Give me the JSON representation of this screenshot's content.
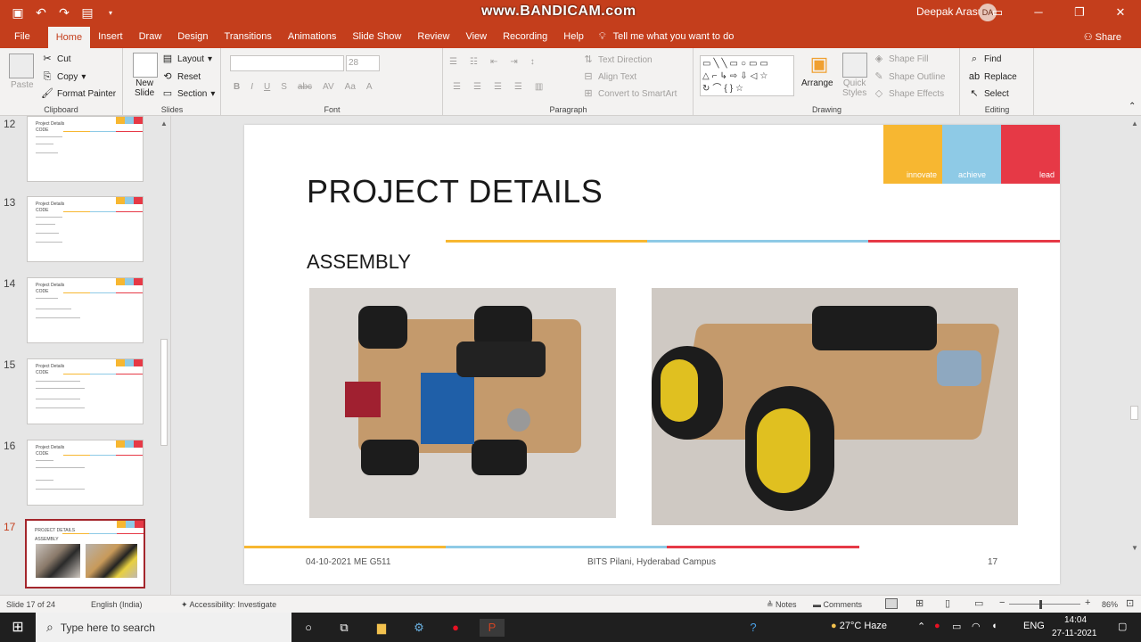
{
  "watermark": "www.BANDICAM.com",
  "user": {
    "name": "Deepak Arasu",
    "initials": "DA"
  },
  "window_controls": {
    "ribbon_display": "ribbon-display-icon",
    "minimize": "─",
    "restore": "❐",
    "close": "✕"
  },
  "qat": {
    "save": "save-icon",
    "undo": "undo-icon",
    "redo": "redo-icon",
    "present": "present-icon"
  },
  "tabs": [
    "File",
    "Home",
    "Insert",
    "Draw",
    "Design",
    "Transitions",
    "Animations",
    "Slide Show",
    "Review",
    "View",
    "Recording",
    "Help"
  ],
  "tell_me": "Tell me what you want to do",
  "share": "Share",
  "ribbon": {
    "clipboard": {
      "paste": "Paste",
      "cut": "Cut",
      "copy": "Copy",
      "format_painter": "Format Painter",
      "label": "Clipboard"
    },
    "slides": {
      "new_slide_1": "New",
      "new_slide_2": "Slide",
      "layout": "Layout",
      "reset": "Reset",
      "section": "Section",
      "label": "Slides"
    },
    "font": {
      "size": "28",
      "label": "Font",
      "bold": "B",
      "italic": "I",
      "underline": "U",
      "shadow": "S",
      "strike": "abc",
      "spacing": "AV",
      "case": "Aa",
      "color": "A"
    },
    "paragraph": {
      "text_direction": "Text Direction",
      "align_text": "Align Text",
      "smartart": "Convert to SmartArt",
      "label": "Paragraph"
    },
    "drawing": {
      "arrange": "Arrange",
      "quick_styles_1": "Quick",
      "quick_styles_2": "Styles",
      "shape_fill": "Shape Fill",
      "shape_outline": "Shape Outline",
      "shape_effects": "Shape Effects",
      "label": "Drawing"
    },
    "editing": {
      "find": "Find",
      "replace": "Replace",
      "select": "Select",
      "label": "Editing"
    }
  },
  "thumbnails": [
    {
      "num": "12",
      "title": "Project Details",
      "sub": "CODE"
    },
    {
      "num": "13",
      "title": "Project Details",
      "sub": "CODE"
    },
    {
      "num": "14",
      "title": "Project Details",
      "sub": "CODE"
    },
    {
      "num": "15",
      "title": "Project Details",
      "sub": "CODE"
    },
    {
      "num": "16",
      "title": "Project Details",
      "sub": "CODE"
    },
    {
      "num": "17",
      "title": "PROJECT DETAILS",
      "sub": "ASSEMBLY"
    }
  ],
  "slide": {
    "banner": [
      "innovate",
      "achieve",
      "lead"
    ],
    "title": "PROJECT DETAILS",
    "subtitle": "ASSEMBLY",
    "footer_date": "04-10-2021 ME G511",
    "footer_center": "BITS Pilani, Hyderabad Campus",
    "footer_num": "17"
  },
  "brand_colors": {
    "orange": "#f7b731",
    "blue": "#8ecae6",
    "red": "#e63946",
    "office": "#c43e1c"
  },
  "status": {
    "slide": "Slide 17 of 24",
    "language": "English (India)",
    "accessibility": "Accessibility: Investigate",
    "notes": "Notes",
    "comments": "Comments",
    "zoom": "86%"
  },
  "taskbar": {
    "search": "Type here to search",
    "weather": "27°C  Haze",
    "lang": "ENG",
    "time": "14:04",
    "date": "27-11-2021"
  }
}
